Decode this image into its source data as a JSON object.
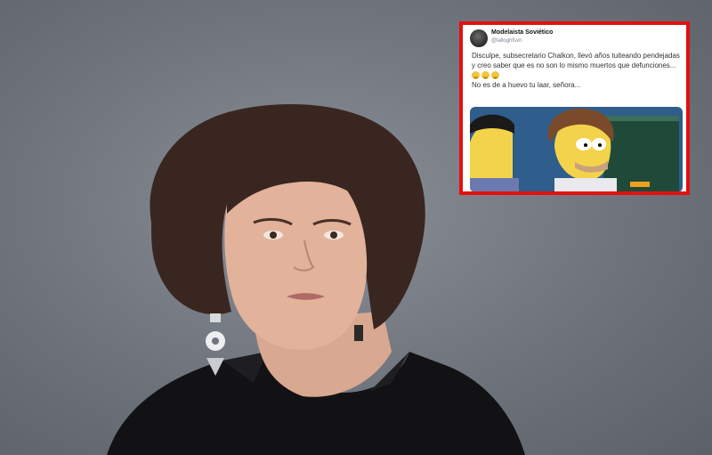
{
  "tweet": {
    "author_name": "Modelaista Soviético",
    "author_handle": "@lalloghfsvn",
    "text_line_1": "Disculpe, subsecretario Chalkon, llevó años tuiteando pendejadas y creo saber que es no son lo mismo muertos que defunciones...",
    "emojis": [
      "face-emoji",
      "face-emoji",
      "face-emoji"
    ],
    "text_line_2": "No es de a huevo tu laar, señora..."
  },
  "colors": {
    "frame_border": "#e3100f",
    "background": "#6f747c"
  }
}
